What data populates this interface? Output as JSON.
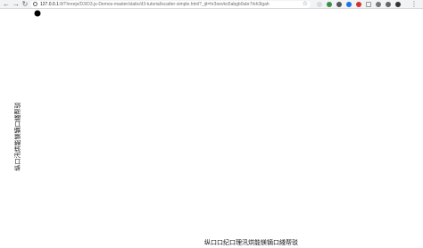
{
  "browser": {
    "url_host": "127.0.0.1",
    "url_path": ":8/Threejs/D3/D3.js-Demos-master/static/d3-tutorial/scatter-simple.html?_ijt=hr3oevko5abgb0ubr7rkh3lgah",
    "nav_icons": [
      "back-arrow-icon",
      "forward-arrow-icon",
      "reload-icon"
    ],
    "extension_colors": [
      "#3c8d40",
      "#555555",
      "#1a73e8",
      "#d32f2f",
      "#999999",
      "#777777",
      "#555555",
      "#333333"
    ]
  },
  "chart": {
    "x_label": "纵口口纪口理汛烘能镁镝口綫帮驳",
    "y_label": "纵口汛烘能镁镝口綫帮驳"
  },
  "chart_data": {
    "type": "scatter",
    "xlabel": "纵口口纪口理汛烘能镁镝口綫帮驳",
    "ylabel": "纵口汛烘能镁镝口綫帮驳",
    "points_visible": 1
  }
}
